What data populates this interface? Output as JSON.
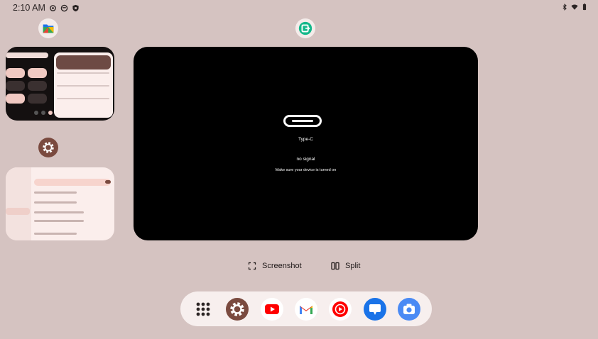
{
  "status_bar": {
    "time": "2:10 AM"
  },
  "recents": {
    "main_card": {
      "port_label": "Type-C",
      "signal_text": "no signal",
      "hint_text": "Make sure your device is turned on"
    }
  },
  "actions": {
    "screenshot_label": "Screenshot",
    "split_label": "Split"
  },
  "colors": {
    "background": "#d5c3c1",
    "dock_background": "#f7efee",
    "settings_brown": "#7a4a3f",
    "youtube_red": "#ff0000",
    "messages_blue": "#1a73e8"
  },
  "dock": {
    "items": [
      {
        "icon": "app-drawer-icon"
      },
      {
        "icon": "settings-icon"
      },
      {
        "icon": "youtube-icon"
      },
      {
        "icon": "gmail-icon"
      },
      {
        "icon": "youtube-music-icon"
      },
      {
        "icon": "screen-share-icon"
      },
      {
        "icon": "camera-icon"
      }
    ]
  }
}
